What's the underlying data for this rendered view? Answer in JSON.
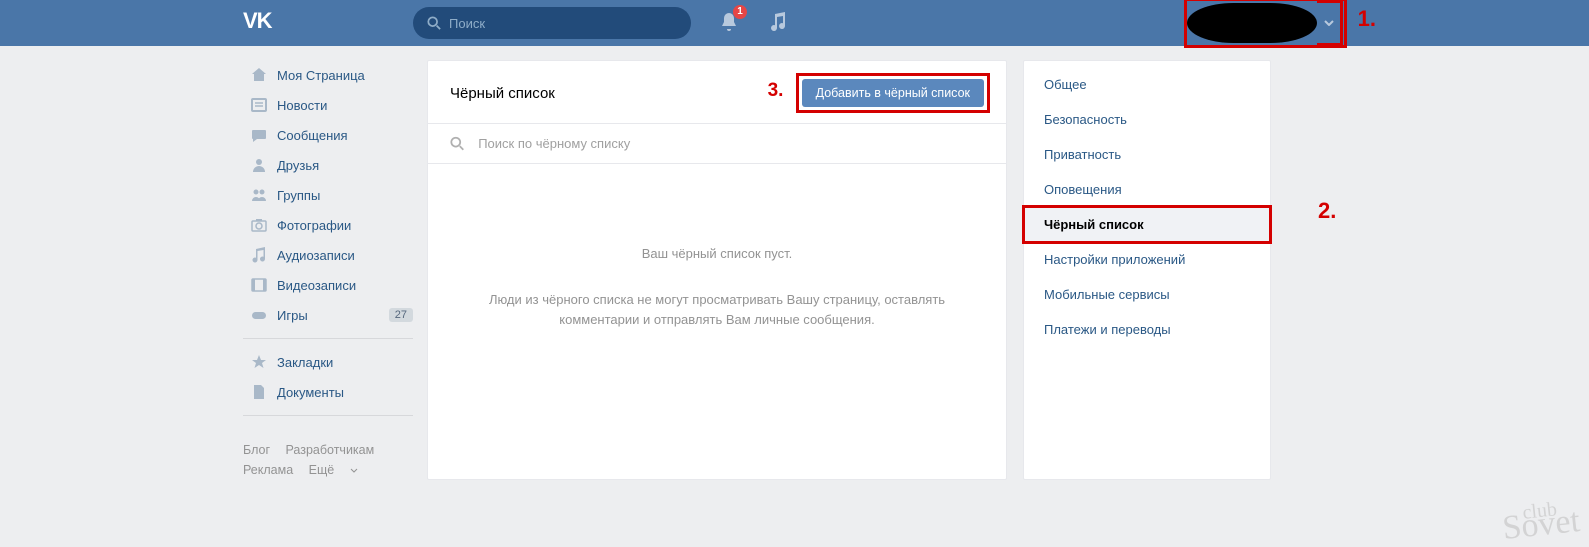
{
  "header": {
    "search_placeholder": "Поиск",
    "notif_badge": "1"
  },
  "sidebar": {
    "items": [
      {
        "label": "Моя Страница"
      },
      {
        "label": "Новости"
      },
      {
        "label": "Сообщения"
      },
      {
        "label": "Друзья"
      },
      {
        "label": "Группы"
      },
      {
        "label": "Фотографии"
      },
      {
        "label": "Аудиозаписи"
      },
      {
        "label": "Видеозаписи"
      },
      {
        "label": "Игры",
        "badge": "27"
      }
    ],
    "items2": [
      {
        "label": "Закладки"
      },
      {
        "label": "Документы"
      }
    ]
  },
  "footer": {
    "blog": "Блог",
    "dev": "Разработчикам",
    "ads": "Реклама",
    "more": "Ещё"
  },
  "main": {
    "title": "Чёрный список",
    "add_button": "Добавить в чёрный список",
    "search_placeholder": "Поиск по чёрному списку",
    "empty_line1": "Ваш чёрный список пуст.",
    "empty_line2": "Люди из чёрного списка не могут просматривать Вашу страницу, оставлять комментарии и отправлять Вам личные сообщения."
  },
  "settings": {
    "items": [
      "Общее",
      "Безопасность",
      "Приватность",
      "Оповещения",
      "Чёрный список",
      "Настройки приложений",
      "Мобильные сервисы",
      "Платежи и переводы"
    ]
  },
  "annotations": {
    "a1": "1.",
    "a2": "2.",
    "a3": "3."
  },
  "watermark": {
    "top": "club",
    "bottom": "Sovet"
  }
}
